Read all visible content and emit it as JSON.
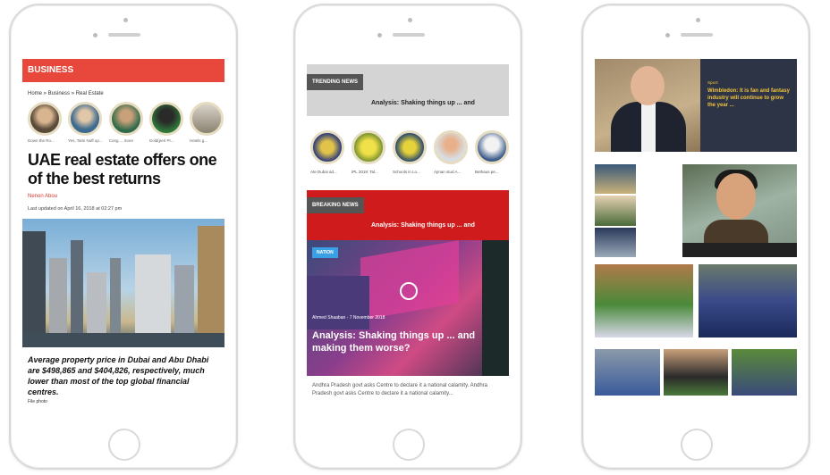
{
  "phone1": {
    "section_label": "BUSINESS",
    "breadcrumb": "Home » Business » Real Estate",
    "thumbs": [
      {
        "caption": "Down the Ro..."
      },
      {
        "caption": "Yes, Tami Nuff up..."
      },
      {
        "caption": "Cong ... more"
      },
      {
        "caption": "Gold(peri Pr..."
      },
      {
        "caption": "Hotels g..."
      }
    ],
    "headline": "UAE real estate offers one of the best returns",
    "author": "Nenon Abou",
    "updated": "Last updated on April 16, 2018 at 02:27 pm",
    "photo_caption": "Average property price in Dubai and Abu Dhabi are $498,865 and $404,826, respectively, much lower than most of the top global financial centres.",
    "photo_credit": "File photo"
  },
  "phone2": {
    "trending_label": "TRENDING NEWS",
    "trending_text": "Analysis: Shaking things up ... and",
    "thumbs": [
      {
        "caption": "Ate Dubai ad..."
      },
      {
        "caption": "IPL 2019: Tal..."
      },
      {
        "caption": "Schools in Lo..."
      },
      {
        "caption": "Ajman stud A..."
      },
      {
        "caption": "Bethaus pe..."
      }
    ],
    "breaking_label": "BREAKING NEWS",
    "breaking_text": "Analysis: Shaking things up ... and",
    "badge": "NATION",
    "meta": "Ahmed Shaaban - 7 November 2018",
    "headline": "Analysis: Shaking things up ... and making them worse?",
    "description": "Andhra Pradesh govt asks Centre to declare it a national calamity. Andhra Pradesh govt asks Centre to declare it a national calamity..."
  },
  "phone3": {
    "tag": "Sport",
    "feature_title": "Wimbledon: It is fan and fantasy industry will continue to grow the year ..."
  }
}
